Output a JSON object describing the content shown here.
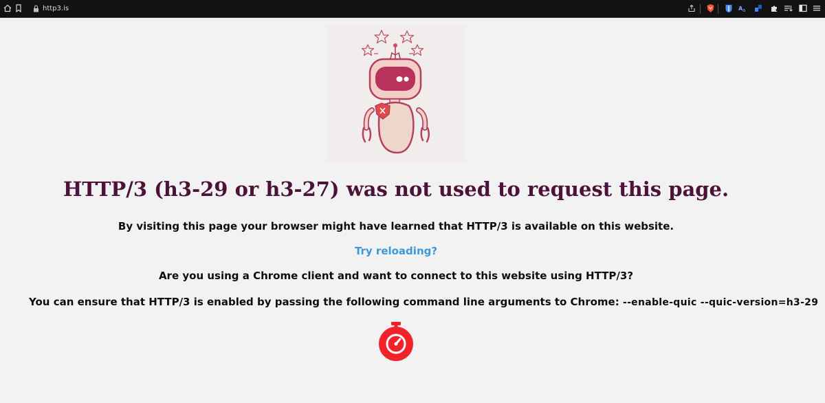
{
  "browser": {
    "url": "http3.is",
    "icons": {
      "home": "home-icon",
      "bookmark": "bookmark-icon",
      "lock": "lock-icon",
      "share": "share-icon",
      "brave": "brave-shield-icon",
      "bitwarden": "bitwarden-icon",
      "translate": "translate-icon",
      "extensions": "puzzle-icon",
      "reading_list": "reading-list-icon",
      "sidebar": "sidebar-icon",
      "menu": "menu-icon"
    }
  },
  "page": {
    "headline": "HTTP/3 (h3-29 or h3-27) was not used to request this page.",
    "learned_text": "By visiting this page your browser might have learned that HTTP/3 is available on this website.",
    "reload_link": "Try reloading?",
    "chrome_question": "Are you using a Chrome client and want to connect to this website using HTTP/3?",
    "ensure_text": "You can ensure that HTTP/3 is enabled by passing the following command line arguments to Chrome: ",
    "command_args": "--enable-quic --quic-version=h3-29",
    "illustration": "broken-robot-illustration",
    "stopwatch": "stopwatch-icon"
  },
  "colors": {
    "background": "#f3f2f3",
    "headline": "#4b1339",
    "link": "#3a9ad9",
    "stopwatch": "#f2222b",
    "robot_outline": "#b3405f",
    "robot_fill": "#f0d0c6"
  }
}
